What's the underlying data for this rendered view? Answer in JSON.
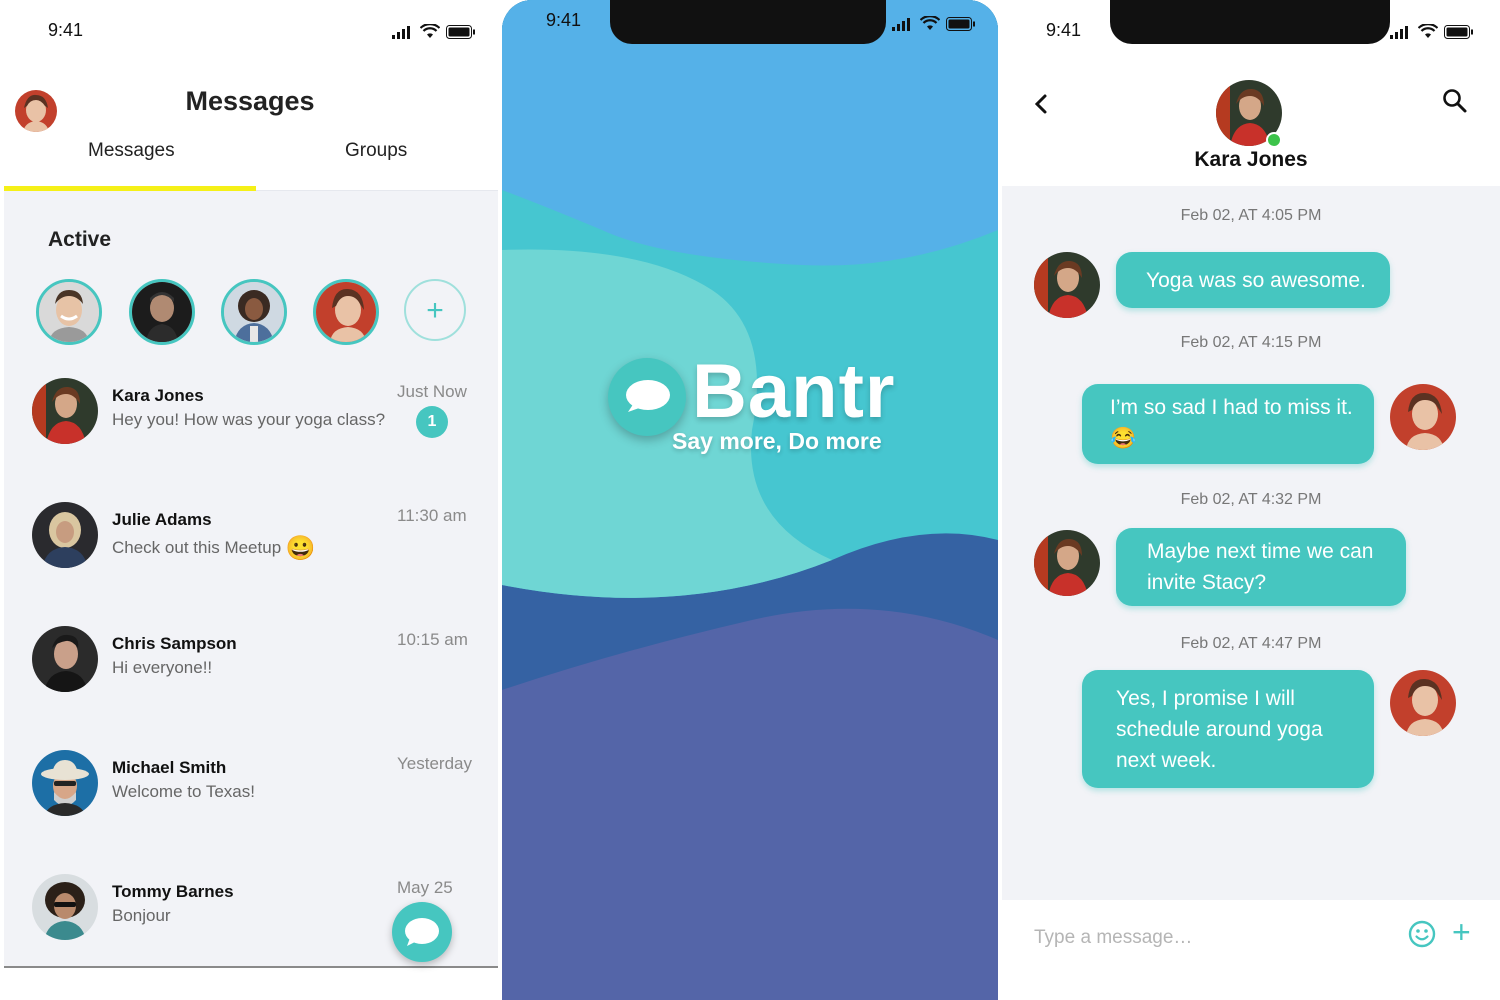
{
  "status_bar": {
    "time": "9:41"
  },
  "messages_screen": {
    "title": "Messages",
    "tabs": [
      {
        "label": "Messages",
        "active": true
      },
      {
        "label": "Groups",
        "active": false
      }
    ],
    "active_section_label": "Active",
    "add_active_icon": "plus-icon",
    "conversations": [
      {
        "name": "Kara Jones",
        "preview": "Hey you! How was your yoga class?",
        "time": "Just Now",
        "unread": "1"
      },
      {
        "name": "Julie Adams",
        "preview": "Check out this Meetup",
        "time": "11:30 am",
        "emoji": "😀"
      },
      {
        "name": "Chris Sampson",
        "preview": "Hi everyone!!",
        "time": "10:15 am"
      },
      {
        "name": "Michael Smith",
        "preview": "Welcome to Texas!",
        "time": "Yesterday"
      },
      {
        "name": "Tommy Barnes",
        "preview": "Bonjour",
        "time": "May 25"
      }
    ],
    "fab_icon": "chat-bubble-icon"
  },
  "splash_screen": {
    "brand": "Bantr",
    "tagline": "Say more, Do more",
    "colors": {
      "sky": "#55b1e8",
      "teal": "#46c6d0",
      "mint": "#6fd6d4",
      "navy": "#3562a3",
      "indigo": "#5465a8"
    }
  },
  "chat_screen": {
    "contact_name": "Kara Jones",
    "online": true,
    "messages": [
      {
        "timestamp": "Feb 02, AT 4:05 PM",
        "from": "them",
        "text": "Yoga was so awesome."
      },
      {
        "timestamp": "Feb 02, AT 4:15 PM",
        "from": "me",
        "text": "I’m so sad I had to miss it. 😂"
      },
      {
        "timestamp": "Feb 02, AT 4:32 PM",
        "from": "them",
        "text": "Maybe next time we can invite Stacy?"
      },
      {
        "timestamp": "Feb 02, AT 4:47 PM",
        "from": "me",
        "text": "Yes, I promise I will schedule around yoga next week."
      }
    ],
    "composer_placeholder": "Type a message…"
  },
  "colors": {
    "accent": "#46c6c0",
    "tab_indicator": "#f5f017",
    "online": "#3cc34a"
  }
}
